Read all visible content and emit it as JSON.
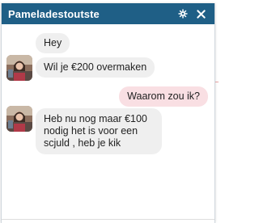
{
  "chat": {
    "title": "Pameladestoutste",
    "icons": {
      "settings": "gear-icon",
      "close": "close-icon"
    }
  },
  "messages": [
    {
      "side": "in",
      "text": "Hey",
      "show_avatar": false
    },
    {
      "side": "in",
      "text": "Wil je €200 overmaken",
      "show_avatar": true
    },
    {
      "side": "out",
      "text": "Waarom zou ik?"
    },
    {
      "side": "in",
      "text": "Heb nu nog maar €100 nodig het is voor een scjuld , heb je kik",
      "show_avatar": true
    }
  ],
  "colors": {
    "header": "#1f5f86",
    "incoming_bubble": "#efefef",
    "outgoing_bubble": "#f9dfe3"
  }
}
